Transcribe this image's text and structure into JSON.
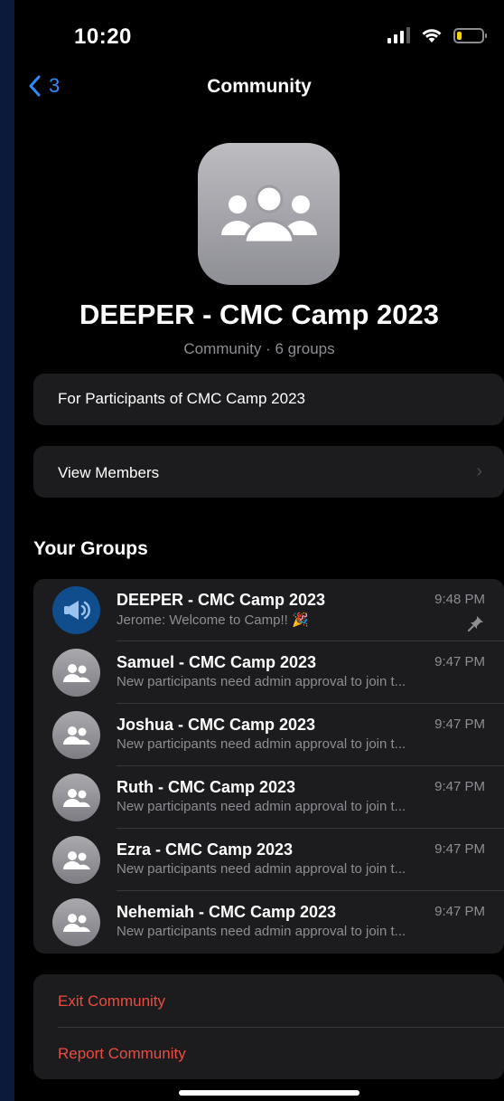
{
  "status_bar": {
    "time": "10:20"
  },
  "nav": {
    "back_label": "3",
    "title": "Community"
  },
  "community": {
    "name": "DEEPER - CMC Camp 2023",
    "subtitle": "Community · 6 groups",
    "description": "For Participants of CMC Camp 2023",
    "view_members_label": "View Members"
  },
  "groups_section": {
    "heading": "Your Groups"
  },
  "groups": [
    {
      "name": "DEEPER - CMC Camp 2023",
      "sender": "Jerome",
      "message": ": Welcome to Camp!! 🎉",
      "time": "9:48 PM",
      "icon": "megaphone-icon",
      "pinned": true
    },
    {
      "name": "Samuel - CMC Camp 2023",
      "sender": "",
      "message": "New participants need admin approval to join t...",
      "time": "9:47 PM",
      "icon": "group-icon"
    },
    {
      "name": "Joshua - CMC Camp 2023",
      "sender": "",
      "message": "New participants need admin approval to join t...",
      "time": "9:47 PM",
      "icon": "group-icon"
    },
    {
      "name": "Ruth - CMC Camp 2023",
      "sender": "",
      "message": "New participants need admin approval to join t...",
      "time": "9:47 PM",
      "icon": "group-icon"
    },
    {
      "name": "Ezra - CMC Camp 2023",
      "sender": "",
      "message": "New participants need admin approval to join t...",
      "time": "9:47 PM",
      "icon": "group-icon"
    },
    {
      "name": "Nehemiah - CMC Camp 2023",
      "sender": "",
      "message": "New participants need admin approval to join t...",
      "time": "9:47 PM",
      "icon": "group-icon"
    }
  ],
  "actions": {
    "exit_label": "Exit Community",
    "report_label": "Report Community"
  },
  "colors": {
    "accent": "#2f8cf7",
    "danger": "#eb4c3f",
    "background": "#000000",
    "card": "#1c1c1e"
  }
}
